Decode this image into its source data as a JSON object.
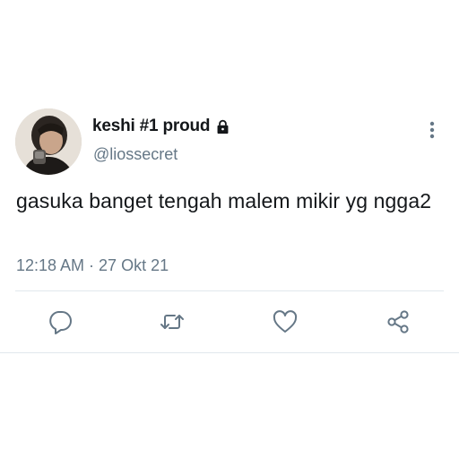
{
  "tweet": {
    "display_name": "keshi #1 proud",
    "handle": "@liossecret",
    "text": "gasuka banget tengah malem mikir yg ngga2",
    "timestamp": "12:18 AM · 27 Okt 21"
  },
  "icons": {
    "badge": "lock-icon",
    "more": "more-vertical-icon",
    "reply": "reply-icon",
    "retweet": "retweet-icon",
    "like": "heart-icon",
    "share": "share-icon"
  },
  "colors": {
    "name": "#14171a",
    "secondary": "#657786",
    "divider": "#e1e8ed"
  }
}
